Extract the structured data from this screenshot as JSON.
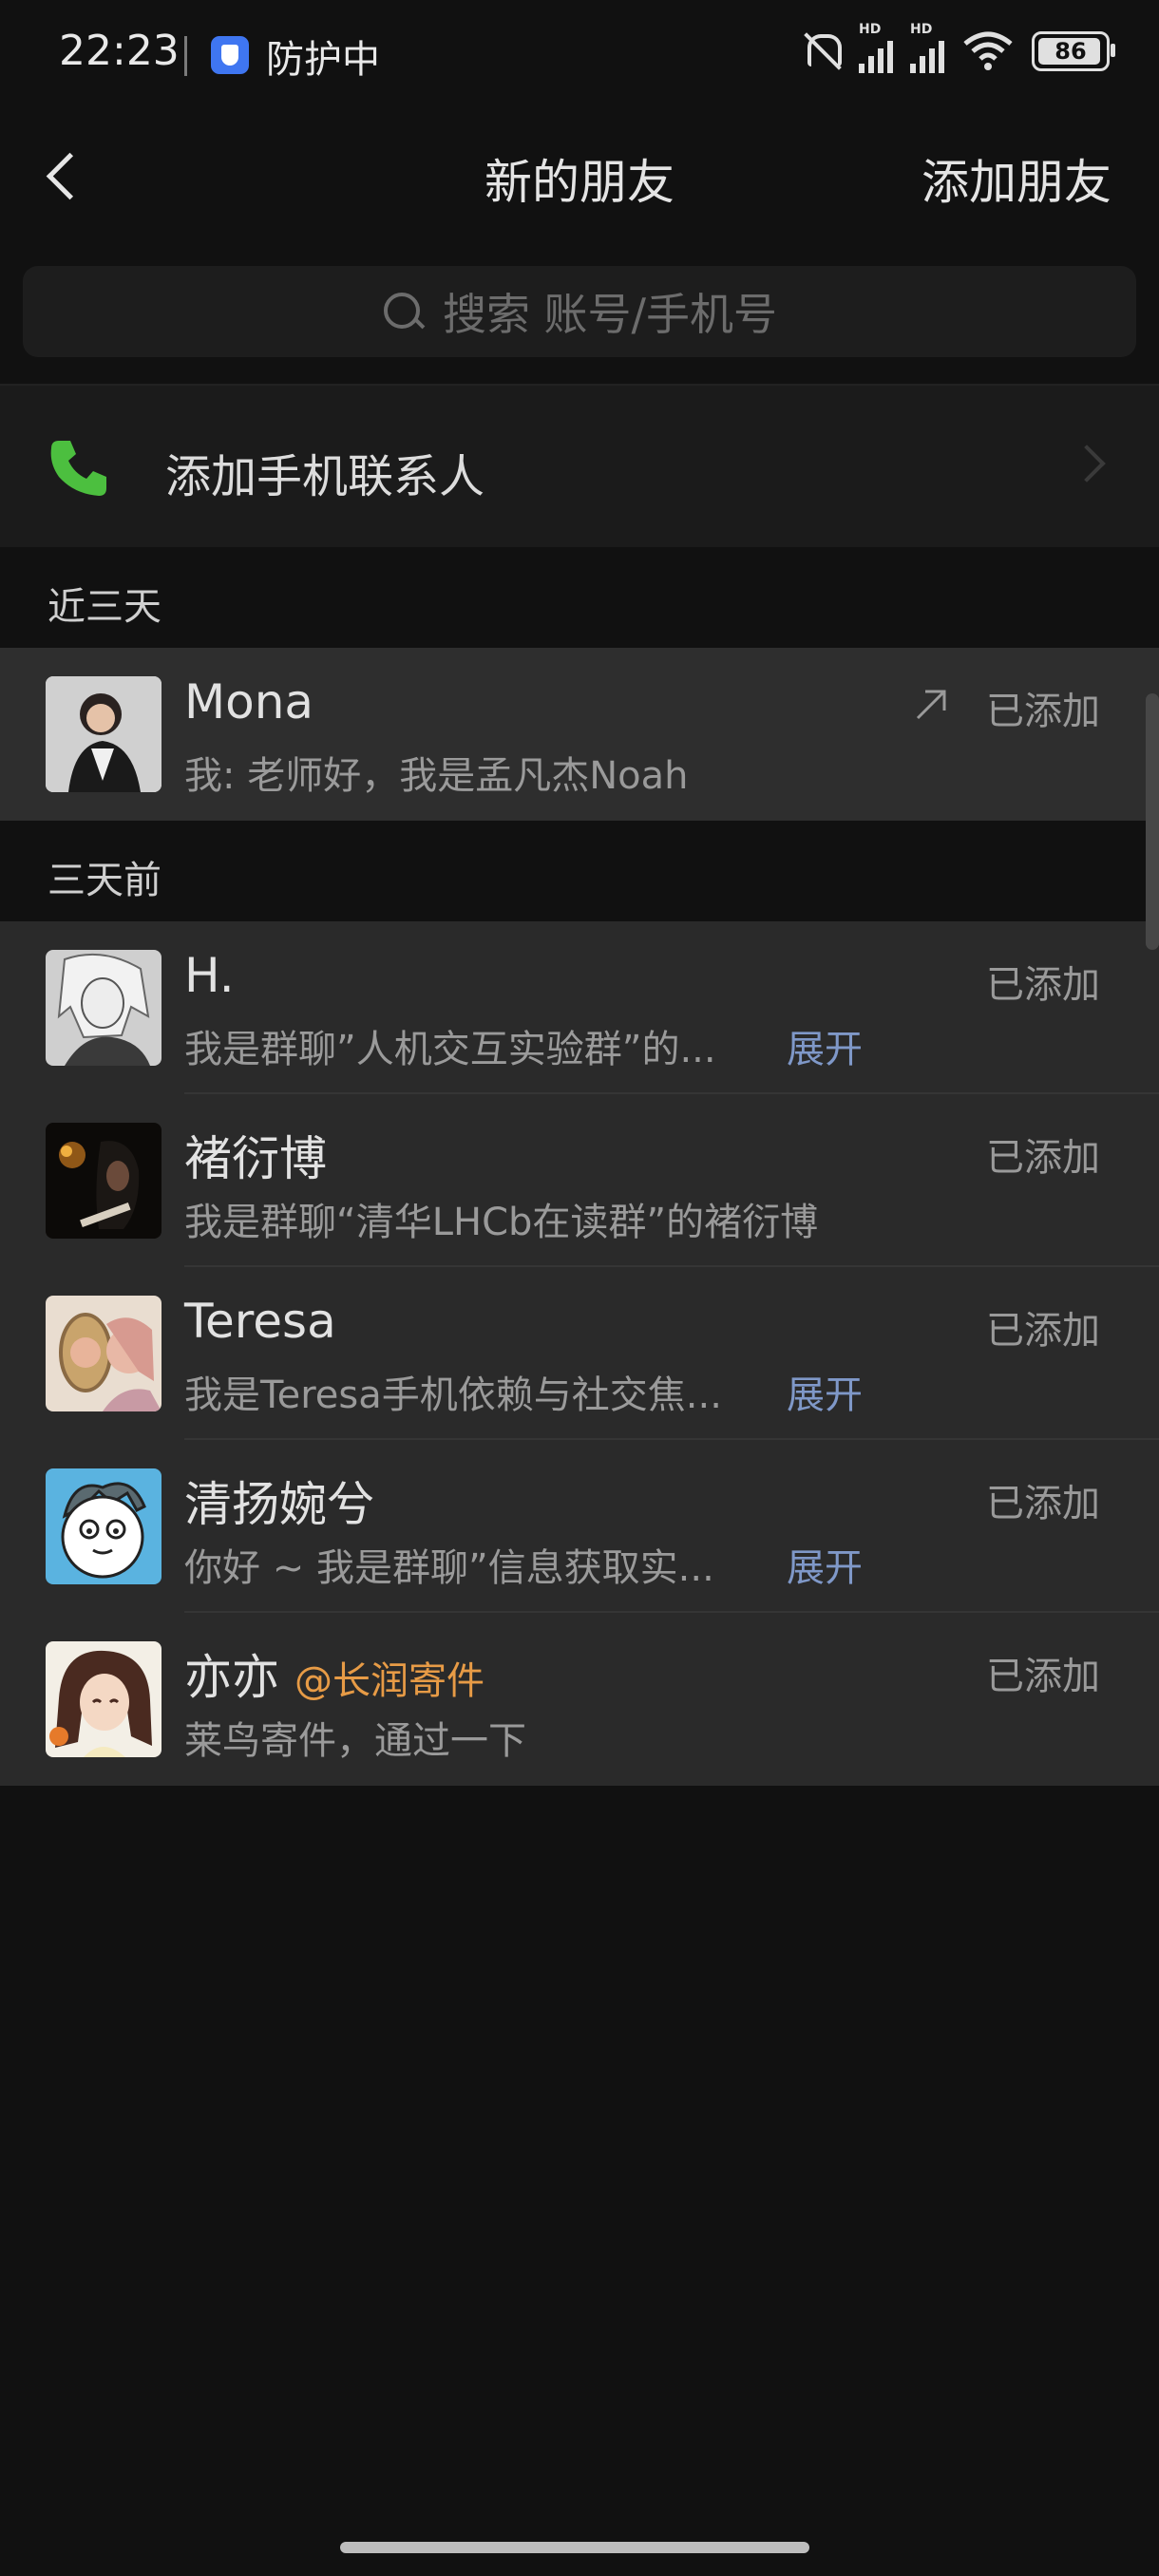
{
  "status_bar": {
    "time": "22:23",
    "protect_label": "防护中",
    "signal_badge_1": "HD",
    "signal_badge_2": "HD",
    "battery": "86",
    "icons": [
      "shield-icon",
      "bell-muted-icon",
      "signal-icon",
      "wifi-icon",
      "battery-icon"
    ]
  },
  "header": {
    "title": "新的朋友",
    "action": "添加朋友",
    "back_icon": "chevron-left-icon"
  },
  "search": {
    "placeholder": "搜索 账号/手机号"
  },
  "add_contacts": {
    "label": "添加手机联系人",
    "icon": "phone-icon",
    "icon_color": "#4cbf3f"
  },
  "sections": [
    {
      "title": "近三天",
      "items": [
        {
          "name": "Mona",
          "message": "我: 老师好，我是孟凡杰Noah",
          "status": "已添加",
          "icon": "arrow-up-right-icon"
        }
      ]
    },
    {
      "title": "三天前",
      "items": [
        {
          "name": "H.",
          "message": "我是群聊”人机交互实验群”的...",
          "expand": "展开",
          "status": "已添加"
        },
        {
          "name": "褚衍博",
          "message": "我是群聊“清华LHCb在读群”的褚衍博",
          "status": "已添加"
        },
        {
          "name": "Teresa",
          "message": "我是Teresa手机依赖与社交焦...",
          "expand": "展开",
          "status": "已添加"
        },
        {
          "name": "清扬婉兮",
          "message": "你好 ~ 我是群聊”信息获取实...",
          "expand": "展开",
          "status": "已添加"
        },
        {
          "name": "亦亦",
          "tag": "@长润寄件",
          "message": "莱鸟寄件，通过一下",
          "status": "已添加"
        }
      ]
    }
  ],
  "colors": {
    "background": "#111111",
    "card": "#2a2a2a",
    "accent_link": "#7f98c8",
    "tag_orange": "#e79b46"
  }
}
